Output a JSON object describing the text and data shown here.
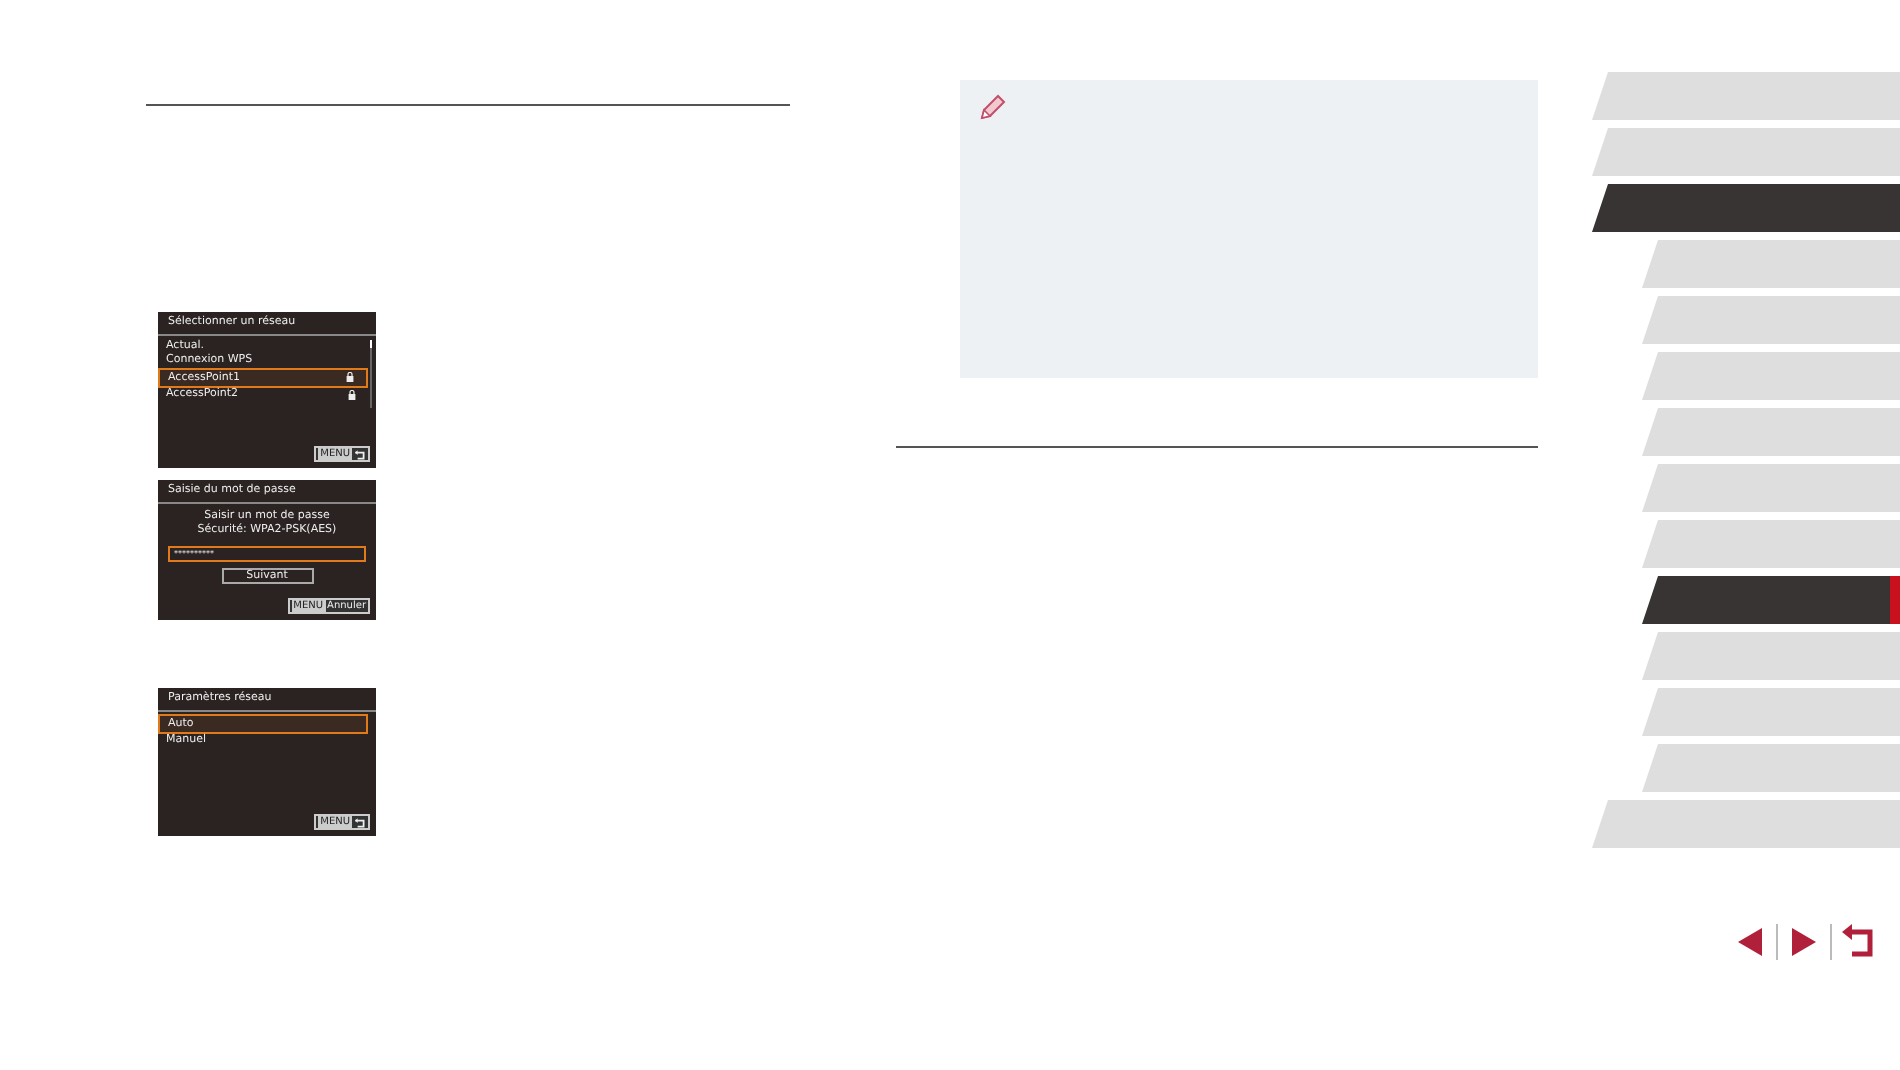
{
  "screens": [
    {
      "kind": "list",
      "title": "Sélectionner un réseau",
      "items": [
        {
          "label": "Actual.",
          "selected": false,
          "locked": false
        },
        {
          "label": "Connexion WPS",
          "selected": false,
          "locked": false
        },
        {
          "label": "AccessPoint1",
          "selected": true,
          "locked": true
        },
        {
          "label": "AccessPoint2",
          "selected": false,
          "locked": true
        }
      ],
      "menu_badge": "MENU"
    },
    {
      "kind": "password",
      "title": "Saisie du mot de passe",
      "lines": [
        "Saisir un mot de passe",
        "Sécurité:  WPA2-PSK(AES)"
      ],
      "value": "**********",
      "button": "Suivant",
      "menu_badge": "MENU",
      "footer": "Annuler"
    },
    {
      "kind": "list",
      "title": "Paramètres réseau",
      "items": [
        {
          "label": "Auto",
          "selected": true,
          "locked": false
        },
        {
          "label": "Manuel",
          "selected": false,
          "locked": false
        }
      ],
      "menu_badge": "MENU"
    }
  ],
  "tabs": [
    {
      "kind": "chapter",
      "selected": false,
      "marked": false
    },
    {
      "kind": "chapter",
      "selected": false,
      "marked": false
    },
    {
      "kind": "chapter",
      "selected": true,
      "marked": false
    },
    {
      "kind": "section",
      "selected": false,
      "marked": false
    },
    {
      "kind": "section",
      "selected": false,
      "marked": false
    },
    {
      "kind": "section",
      "selected": false,
      "marked": false
    },
    {
      "kind": "section",
      "selected": false,
      "marked": false
    },
    {
      "kind": "section",
      "selected": false,
      "marked": false
    },
    {
      "kind": "section",
      "selected": false,
      "marked": false
    },
    {
      "kind": "section",
      "selected": true,
      "marked": true
    },
    {
      "kind": "section",
      "selected": false,
      "marked": false
    },
    {
      "kind": "section",
      "selected": false,
      "marked": false
    },
    {
      "kind": "section",
      "selected": false,
      "marked": false
    },
    {
      "kind": "chapter",
      "selected": false,
      "marked": false
    }
  ]
}
